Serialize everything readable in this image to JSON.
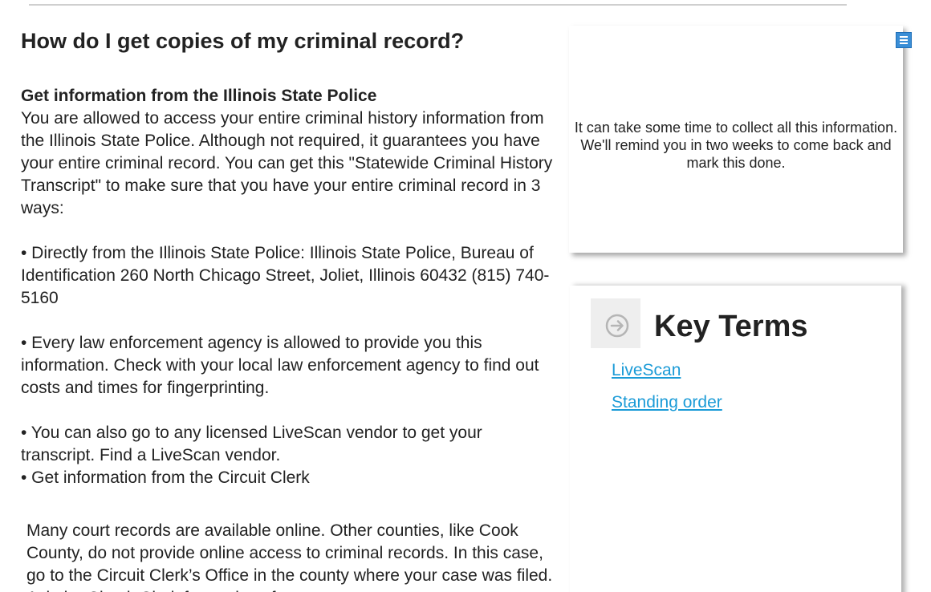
{
  "main": {
    "heading": "How do I get copies of my criminal record?",
    "subheading": "Get information from the Illinois State Police",
    "intro": "You are allowed to access your entire criminal history information from the Illinois State Police. Although not required, it guarantees you have your entire criminal record. You can get this \"Statewide Criminal History Transcript\" to make sure that you have your entire criminal record in 3 ways:",
    "bullet_1": "• Directly from the Illinois State Police: Illinois State Police, Bureau of Identification 260 North Chicago Street, Joliet, Illinois 60432 (815) 740-5160",
    "bullet_2": "• Every law enforcement agency is allowed to provide you this information. Check with your local law enforcement agency to find out costs and times for fingerprinting.",
    "bullet_3": "• You can also go to any licensed LiveScan vendor to get your transcript. Find a LiveScan vendor.",
    "bullet_4": "• Get information from the Circuit Clerk",
    "circuit_clerk": "Many court records are available online. Other counties, like Cook County, do not provide online access to criminal records. In this case, go to the Circuit Clerk’s Office in the county where your case was filed. Ask the Circuit Clerk for copies of your"
  },
  "reminder": {
    "text": "It can take some time to collect all this information.  We'll remind you in two weeks to come back and mark this done.",
    "menu_icon": "menu-icon"
  },
  "key_terms": {
    "title": "Key Terms",
    "icon": "circle-arrow-right-icon",
    "links": [
      "LiveScan",
      "Standing order"
    ]
  },
  "colors": {
    "link": "#1b9bd7",
    "menu_icon": "#3a8ed6",
    "text": "#222222"
  }
}
